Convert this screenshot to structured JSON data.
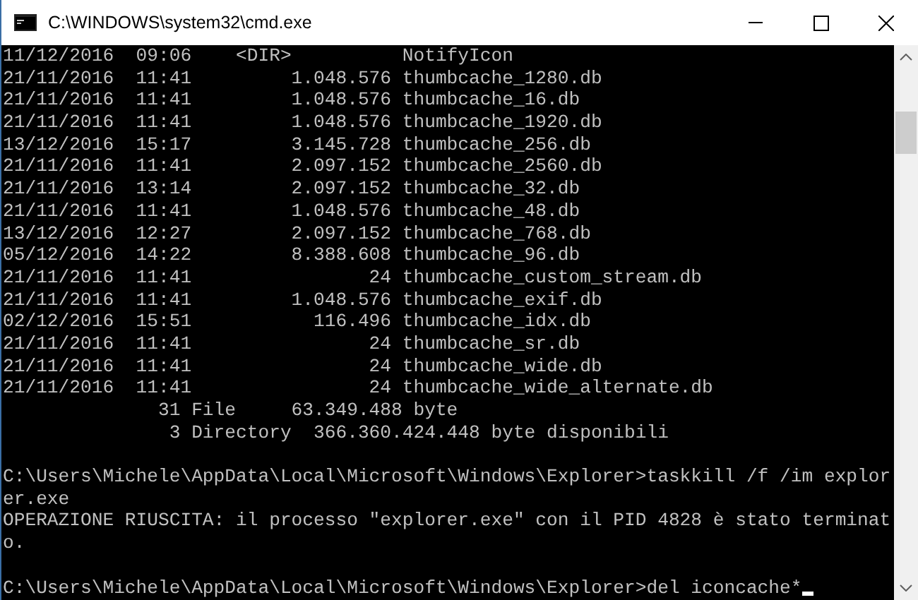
{
  "window": {
    "title": "C:\\WINDOWS\\system32\\cmd.exe"
  },
  "console": {
    "cursor": true,
    "blocks": [
      [
        "11/12/2016  09:06    <DIR>          NotifyIcon",
        "21/11/2016  11:41         1.048.576 thumbcache_1280.db",
        "21/11/2016  11:41         1.048.576 thumbcache_16.db",
        "21/11/2016  11:41         1.048.576 thumbcache_1920.db",
        "13/12/2016  15:17         3.145.728 thumbcache_256.db",
        "21/11/2016  11:41         2.097.152 thumbcache_2560.db",
        "21/11/2016  13:14         2.097.152 thumbcache_32.db",
        "21/11/2016  11:41         1.048.576 thumbcache_48.db",
        "13/12/2016  12:27         2.097.152 thumbcache_768.db",
        "05/12/2016  14:22         8.388.608 thumbcache_96.db",
        "21/11/2016  11:41                24 thumbcache_custom_stream.db",
        "21/11/2016  11:41         1.048.576 thumbcache_exif.db",
        "02/12/2016  15:51           116.496 thumbcache_idx.db",
        "21/11/2016  11:41                24 thumbcache_sr.db",
        "21/11/2016  11:41                24 thumbcache_wide.db",
        "21/11/2016  11:41                24 thumbcache_wide_alternate.db",
        "              31 File     63.349.488 byte",
        "               3 Directory  366.360.424.448 byte disponibili"
      ],
      [
        "C:\\Users\\Michele\\AppData\\Local\\Microsoft\\Windows\\Explorer>taskkill /f /im explor",
        "er.exe",
        "OPERAZIONE RIUSCITA: il processo \"explorer.exe\" con il PID 4828 è stato terminat",
        "o."
      ],
      [
        "C:\\Users\\Michele\\AppData\\Local\\Microsoft\\Windows\\Explorer>del iconcache*"
      ]
    ]
  }
}
